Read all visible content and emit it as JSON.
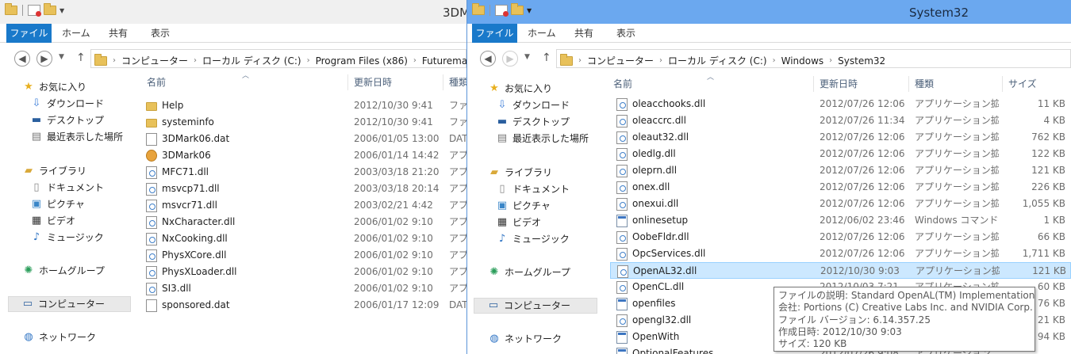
{
  "left": {
    "title": "3DM",
    "ribbon_tabs": [
      "ファイル",
      "ホーム",
      "共有",
      "表示"
    ],
    "breadcrumbs": [
      "コンピューター",
      "ローカル ディスク (C:)",
      "Program Files (x86)",
      "Futuremark"
    ],
    "nav": {
      "favorites": "お気に入り",
      "downloads": "ダウンロード",
      "desktop": "デスクトップ",
      "recent": "最近表示した場所",
      "libraries": "ライブラリ",
      "documents": "ドキュメント",
      "pictures": "ピクチャ",
      "videos": "ビデオ",
      "music": "ミュージック",
      "homegroup": "ホームグループ",
      "computer": "コンピューター",
      "network": "ネットワーク"
    },
    "columns": {
      "name": "名前",
      "date": "更新日時",
      "type": "種類"
    },
    "files": [
      {
        "name": "Help",
        "date": "2012/10/30 9:41",
        "type": "ファイ",
        "icon": "folder"
      },
      {
        "name": "systeminfo",
        "date": "2012/10/30 9:41",
        "type": "ファイ",
        "icon": "folder"
      },
      {
        "name": "3DMark06.dat",
        "date": "2006/01/05 13:00",
        "type": "DAT",
        "icon": "doc"
      },
      {
        "name": "3DMark06",
        "date": "2006/01/14 14:42",
        "type": "アプリ",
        "icon": "app"
      },
      {
        "name": "MFC71.dll",
        "date": "2003/03/18 21:20",
        "type": "アプリ",
        "icon": "dll"
      },
      {
        "name": "msvcp71.dll",
        "date": "2003/03/18 20:14",
        "type": "アプリ",
        "icon": "dll"
      },
      {
        "name": "msvcr71.dll",
        "date": "2003/02/21 4:42",
        "type": "アプリ",
        "icon": "dll"
      },
      {
        "name": "NxCharacter.dll",
        "date": "2006/01/02 9:10",
        "type": "アプリ",
        "icon": "dll"
      },
      {
        "name": "NxCooking.dll",
        "date": "2006/01/02 9:10",
        "type": "アプリ",
        "icon": "dll"
      },
      {
        "name": "PhysXCore.dll",
        "date": "2006/01/02 9:10",
        "type": "アプリ",
        "icon": "dll"
      },
      {
        "name": "PhysXLoader.dll",
        "date": "2006/01/02 9:10",
        "type": "アプリ",
        "icon": "dll"
      },
      {
        "name": "SI3.dll",
        "date": "2006/01/02 9:10",
        "type": "アプリ",
        "icon": "dll"
      },
      {
        "name": "sponsored.dat",
        "date": "2006/01/17 12:09",
        "type": "DAT",
        "icon": "doc"
      }
    ]
  },
  "right": {
    "title": "System32",
    "ribbon_tabs": [
      "ファイル",
      "ホーム",
      "共有",
      "表示"
    ],
    "breadcrumbs": [
      "コンピューター",
      "ローカル ディスク (C:)",
      "Windows",
      "System32"
    ],
    "nav": {
      "favorites": "お気に入り",
      "downloads": "ダウンロード",
      "desktop": "デスクトップ",
      "recent": "最近表示した場所",
      "libraries": "ライブラリ",
      "documents": "ドキュメント",
      "pictures": "ピクチャ",
      "videos": "ビデオ",
      "music": "ミュージック",
      "homegroup": "ホームグループ",
      "computer": "コンピューター",
      "network": "ネットワーク"
    },
    "columns": {
      "name": "名前",
      "date": "更新日時",
      "type": "種類",
      "size": "サイズ"
    },
    "files": [
      {
        "name": "oleacchooks.dll",
        "date": "2012/07/26 12:06",
        "type": "アプリケーション拡張",
        "size": "11 KB",
        "icon": "dll"
      },
      {
        "name": "oleaccrc.dll",
        "date": "2012/07/26 11:34",
        "type": "アプリケーション拡張",
        "size": "4 KB",
        "icon": "dll"
      },
      {
        "name": "oleaut32.dll",
        "date": "2012/07/26 12:06",
        "type": "アプリケーション拡張",
        "size": "762 KB",
        "icon": "dll"
      },
      {
        "name": "oledlg.dll",
        "date": "2012/07/26 12:06",
        "type": "アプリケーション拡張",
        "size": "122 KB",
        "icon": "dll"
      },
      {
        "name": "oleprn.dll",
        "date": "2012/07/26 12:06",
        "type": "アプリケーション拡張",
        "size": "121 KB",
        "icon": "dll"
      },
      {
        "name": "onex.dll",
        "date": "2012/07/26 12:06",
        "type": "アプリケーション拡張",
        "size": "226 KB",
        "icon": "dll"
      },
      {
        "name": "onexui.dll",
        "date": "2012/07/26 12:06",
        "type": "アプリケーション拡張",
        "size": "1,055 KB",
        "icon": "dll"
      },
      {
        "name": "onlinesetup",
        "date": "2012/06/02 23:46",
        "type": "Windows コマンド ...",
        "size": "1 KB",
        "icon": "exe"
      },
      {
        "name": "OobeFldr.dll",
        "date": "2012/07/26 12:06",
        "type": "アプリケーション拡張",
        "size": "66 KB",
        "icon": "dll"
      },
      {
        "name": "OpcServices.dll",
        "date": "2012/07/26 12:06",
        "type": "アプリケーション拡張",
        "size": "1,711 KB",
        "icon": "dll"
      },
      {
        "name": "OpenAL32.dll",
        "date": "2012/10/30 9:03",
        "type": "アプリケーション拡張",
        "size": "121 KB",
        "icon": "dll",
        "selected": true
      },
      {
        "name": "OpenCL.dll",
        "date": "2012/10/03 7:21",
        "type": "アプリケーション拡張",
        "size": "60 KB",
        "icon": "dll"
      },
      {
        "name": "openfiles",
        "date": "",
        "type": "",
        "size": "76 KB",
        "icon": "exe"
      },
      {
        "name": "opengl32.dll",
        "date": "",
        "type": "",
        "size": "21 KB",
        "icon": "dll"
      },
      {
        "name": "OpenWith",
        "date": "",
        "type": "",
        "size": "94 KB",
        "icon": "exe"
      },
      {
        "name": "OptionalFeatures",
        "date": "2012/07/26 9:08",
        "type": "アプリケーション",
        "size": "",
        "icon": "exe"
      }
    ],
    "tooltip": [
      "ファイルの説明: Standard OpenAL(TM) Implementation",
      "会社: Portions (C) Creative Labs Inc. and NVIDIA Corp.",
      "ファイル バージョン: 6.14.357.25",
      "作成日時: 2012/10/30 9:03",
      "サイズ: 120 KB"
    ]
  }
}
